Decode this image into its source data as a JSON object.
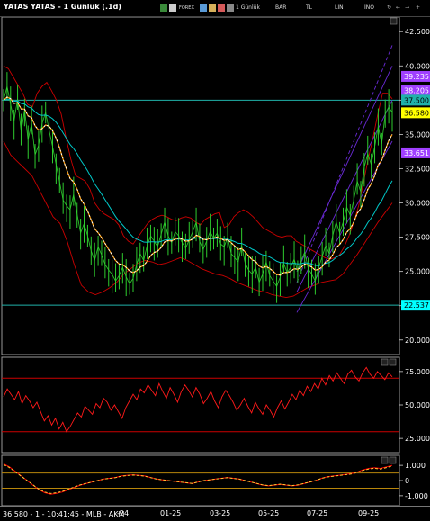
{
  "window": {
    "title": "YATAS YATAS - 1 Günlük (.1d)",
    "toolbar": {
      "forex_label": "FOREX",
      "period_label": "1 Günlük",
      "type_label": "BAR",
      "currency_label": "TL",
      "scale_label": "LIN",
      "indicator_label": "İNO"
    }
  },
  "status": {
    "text": "36.580 - 1 - 10:41:45 - MLB - AKM"
  },
  "colors": {
    "price_line": "#2ecc2e",
    "ema_fast": "#ffffff",
    "ema_orange": "#ff9900",
    "ma_cyan": "#00c8c8",
    "bollinger": "#cc0000",
    "channel": "#6a2ad6",
    "horizontal_line": "#20b2aa",
    "last_price_badge": "#ffff00",
    "level_badge": "#a040ff",
    "support_badge": "#00ffff",
    "rsi_line": "#ff1a1a",
    "osc_line": "#ff0000"
  },
  "chart_data": [
    {
      "type": "line",
      "panel": "price",
      "ylim": [
        19.0,
        43.5
      ],
      "y_ticks": [
        "20.000",
        "22.500",
        "25.000",
        "27.500",
        "30.000",
        "32.500",
        "35.000",
        "37.500",
        "40.000",
        "42.500"
      ],
      "x_ticks": [
        "-24",
        "01-25",
        "03-25",
        "05-25",
        "07-25",
        "09-25"
      ],
      "series": [
        {
          "values": [
            37.5,
            38.5,
            37.2,
            36.0,
            37.6,
            35.2,
            36.8,
            34.6,
            35.8,
            33.5,
            34.2,
            35.8,
            36.6,
            35.3,
            34.1,
            32.8,
            31.5,
            30.2,
            29.8,
            29.5,
            30.6,
            29.2,
            27.8,
            28.5,
            27.6,
            26.5,
            25.8,
            26.8,
            26.2,
            25.5,
            25.1,
            24.8,
            24.3,
            24.7,
            25.3,
            24.6,
            24.1,
            24.5,
            25.5,
            26.3,
            25.8,
            26.9,
            27.6,
            27.2,
            26.8,
            27.7,
            28.6,
            27.6,
            27.1,
            27.9,
            27.6,
            27.1,
            26.7,
            27.3,
            27.9,
            28.6,
            27.2,
            26.6,
            27.2,
            27.9,
            27.4,
            27.8,
            27.0,
            26.8,
            27.5,
            26.3,
            26.0,
            25.7,
            26.9,
            25.6,
            25.1,
            24.8,
            25.3,
            24.2,
            24.8,
            25.7,
            24.7,
            24.3,
            23.9,
            24.6,
            25.6,
            24.9,
            25.3,
            25.9,
            25.0,
            25.8,
            26.4,
            25.2,
            24.8,
            24.3,
            25.3,
            26.1,
            26.9,
            26.3,
            27.6,
            28.6,
            27.8,
            28.6,
            29.7,
            29.1,
            30.2,
            31.6,
            30.8,
            32.6,
            33.6,
            32.8,
            34.1,
            35.6,
            34.3,
            36.5,
            37.0,
            36.6
          ]
        },
        {
          "name": "",
          "values": []
        }
      ],
      "bollinger_upper_values": [
        40.0,
        39.8,
        39.2,
        38.6,
        38.0,
        37.2,
        37.0,
        38.0,
        38.5,
        38.8,
        38.2,
        37.5,
        36.5,
        34.8,
        33.2,
        32.0,
        31.8,
        31.6,
        31.0,
        30.0,
        29.5,
        29.2,
        29.0,
        28.8,
        28.4,
        27.6,
        27.2,
        27.0,
        27.5,
        28.0,
        28.5,
        28.8,
        29.0,
        29.1,
        29.0,
        28.8,
        28.7,
        28.9,
        29.0,
        28.9,
        28.6,
        28.4,
        28.8,
        29.0,
        29.2,
        29.3,
        28.2,
        28.4,
        29.0,
        29.3,
        29.5,
        29.3,
        29.0,
        28.6,
        28.2,
        28.0,
        27.8,
        27.6,
        27.5,
        27.6,
        27.6,
        27.2,
        27.0,
        26.8,
        26.6,
        26.4,
        26.2,
        26.0,
        25.9,
        26.0,
        26.2,
        26.8,
        27.6,
        28.6,
        29.8,
        31.5,
        33.2,
        34.8,
        36.5,
        38.0,
        38.0,
        37.6
      ],
      "bollinger_lower_values": [
        34.5,
        33.5,
        33.0,
        32.5,
        32.0,
        31.0,
        30.0,
        29.0,
        28.5,
        27.2,
        25.5,
        24.0,
        23.5,
        23.3,
        23.5,
        23.8,
        24.2,
        24.8,
        25.2,
        25.6,
        25.8,
        25.7,
        25.5,
        25.6,
        25.8,
        26.0,
        25.8,
        25.5,
        25.2,
        25.0,
        24.8,
        24.7,
        24.5,
        24.2,
        24.0,
        23.8,
        23.6,
        23.5,
        23.3,
        23.2,
        23.1,
        23.2,
        23.5,
        23.8,
        24.0,
        24.2,
        24.3,
        24.4,
        24.8,
        25.5,
        26.2,
        27.0,
        27.8,
        28.6,
        29.3,
        30.0
      ],
      "horizontal_levels": [
        37.5,
        22.537
      ],
      "price_badges": [
        "39.235",
        "38.205",
        "37.500",
        "36.580",
        "33.651",
        "22.537"
      ]
    },
    {
      "type": "line",
      "panel": "rsi",
      "ylim": [
        15,
        85
      ],
      "y_ticks": [
        "25.000",
        "50.000",
        "75.000"
      ],
      "levels": [
        70,
        30
      ],
      "values": [
        56,
        62,
        58,
        54,
        60,
        51,
        57,
        53,
        48,
        52,
        45,
        38,
        42,
        35,
        40,
        32,
        37,
        30,
        34,
        39,
        44,
        41,
        49,
        46,
        43,
        51,
        48,
        55,
        52,
        46,
        50,
        45,
        40,
        48,
        53,
        58,
        54,
        62,
        59,
        65,
        61,
        57,
        66,
        60,
        55,
        63,
        58,
        52,
        60,
        65,
        61,
        56,
        63,
        58,
        51,
        55,
        60,
        53,
        48,
        56,
        61,
        57,
        52,
        46,
        50,
        55,
        49,
        44,
        52,
        47,
        43,
        50,
        46,
        41,
        48,
        53,
        47,
        52,
        58,
        54,
        61,
        57,
        64,
        60,
        66,
        62,
        70,
        65,
        72,
        68,
        74,
        70,
        66,
        73,
        76,
        71,
        68,
        74,
        78,
        73,
        70,
        75,
        72,
        69,
        74,
        71
      ]
    },
    {
      "type": "line",
      "panel": "oscillator",
      "ylim": [
        -1.6,
        1.6
      ],
      "y_ticks": [
        "-1.000",
        "0",
        "1.000"
      ],
      "values": [
        1.1,
        0.9,
        0.6,
        0.3,
        0.0,
        -0.3,
        -0.6,
        -0.8,
        -0.9,
        -0.85,
        -0.75,
        -0.6,
        -0.45,
        -0.3,
        -0.2,
        -0.1,
        0.0,
        0.1,
        0.15,
        0.2,
        0.3,
        0.35,
        0.38,
        0.35,
        0.3,
        0.2,
        0.1,
        0.05,
        0.0,
        -0.05,
        -0.1,
        -0.15,
        -0.2,
        -0.1,
        0.0,
        0.05,
        0.1,
        0.15,
        0.2,
        0.15,
        0.1,
        0.0,
        -0.1,
        -0.2,
        -0.3,
        -0.35,
        -0.3,
        -0.25,
        -0.3,
        -0.35,
        -0.3,
        -0.2,
        -0.1,
        0.0,
        0.15,
        0.25,
        0.3,
        0.35,
        0.4,
        0.45,
        0.55,
        0.7,
        0.8,
        0.85,
        0.8,
        0.9,
        1.0
      ]
    }
  ]
}
